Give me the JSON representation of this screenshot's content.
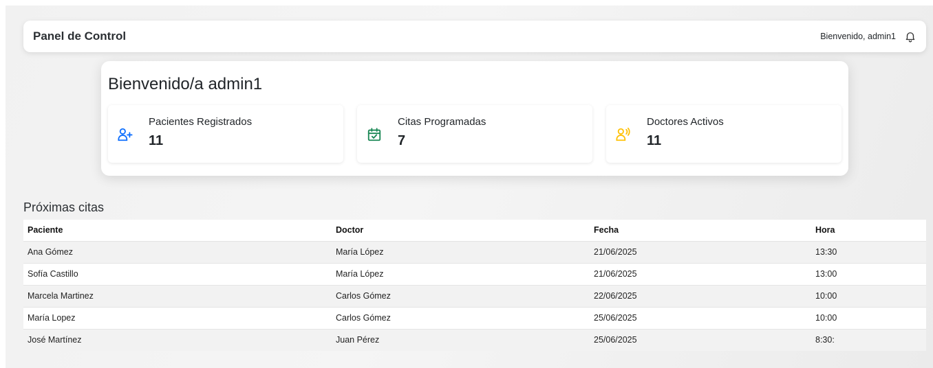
{
  "header": {
    "title": "Panel de Control",
    "welcome": "Bienvenido, admin1",
    "bell_icon": "bell-icon"
  },
  "welcome_card": {
    "heading": "Bienvenido/a admin1",
    "stats": [
      {
        "label": "Pacientes Registrados",
        "value": "11",
        "icon": "user-plus-icon",
        "color": "#0d6efd"
      },
      {
        "label": "Citas Programadas",
        "value": "7",
        "icon": "calendar-check-icon",
        "color": "#198754"
      },
      {
        "label": "Doctores Activos",
        "value": "11",
        "icon": "user-voice-icon",
        "color": "#ffc107"
      }
    ]
  },
  "appointments": {
    "title": "Próximas citas",
    "columns": [
      "Paciente",
      "Doctor",
      "Fecha",
      "Hora"
    ],
    "rows": [
      [
        "Ana Gómez",
        "María López",
        "21/06/2025",
        "13:30"
      ],
      [
        "Sofía Castillo",
        "María López",
        "21/06/2025",
        "13:00"
      ],
      [
        "Marcela Martinez",
        "Carlos Gómez",
        "22/06/2025",
        "10:00"
      ],
      [
        "María Lopez",
        "Carlos Gómez",
        "25/06/2025",
        "10:00"
      ],
      [
        "José Martínez",
        "Juan Pérez",
        "25/06/2025",
        "8:30:"
      ]
    ]
  }
}
